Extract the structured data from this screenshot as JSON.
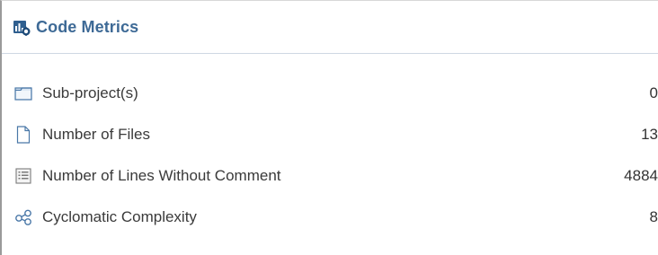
{
  "panel": {
    "title": "Code Metrics",
    "title_icon": "code-metrics-icon",
    "accent_color": "#3e6a96"
  },
  "metrics": [
    {
      "label": "Sub-project(s)",
      "value": "0",
      "icon": "folder-icon"
    },
    {
      "label": "Number of Files",
      "value": "13",
      "icon": "file-icon"
    },
    {
      "label": "Number of Lines Without Comment",
      "value": "4884",
      "icon": "lines-list-icon"
    },
    {
      "label": "Cyclomatic Complexity",
      "value": "8",
      "icon": "graph-nodes-icon"
    }
  ]
}
